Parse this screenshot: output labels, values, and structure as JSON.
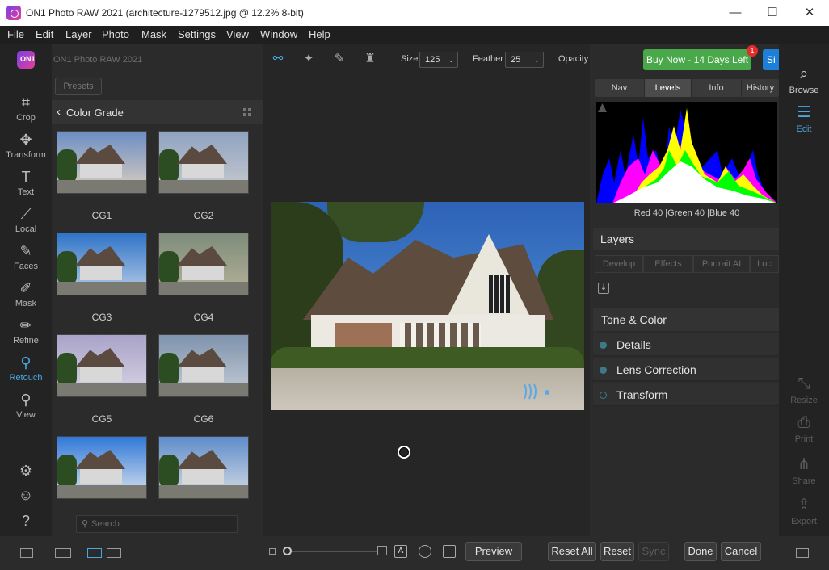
{
  "window": {
    "title": "ON1 Photo RAW 2021 (architecture-1279512.jpg @ 12.2% 8-bit)",
    "minimize": "—",
    "maximize": "☐",
    "close": "✕"
  },
  "menu": [
    "File",
    "Edit",
    "Layer",
    "Photo",
    "Mask",
    "Settings",
    "View",
    "Window",
    "Help"
  ],
  "left_tools": [
    {
      "label": "Crop",
      "icon": "crop-icon",
      "glyph": "⌗"
    },
    {
      "label": "Transform",
      "icon": "transform-icon",
      "glyph": "✥"
    },
    {
      "label": "Text",
      "icon": "text-icon",
      "glyph": "T"
    },
    {
      "label": "Local",
      "icon": "local-brush-icon",
      "glyph": "⟋"
    },
    {
      "label": "Faces",
      "icon": "faces-icon",
      "glyph": "✎"
    },
    {
      "label": "Mask",
      "icon": "mask-icon",
      "glyph": "✐"
    },
    {
      "label": "Refine",
      "icon": "refine-icon",
      "glyph": "✏"
    },
    {
      "label": "Retouch",
      "icon": "retouch-icon",
      "glyph": "⚲",
      "active": true
    },
    {
      "label": "View",
      "icon": "view-zoom-icon",
      "glyph": "⚲"
    }
  ],
  "logo_text": "ON1",
  "browser": {
    "app_name": "ON1 Photo RAW 2021",
    "presets_button": "Presets",
    "category_title": "Color Grade",
    "search_placeholder": "Search",
    "presets": [
      {
        "label": "CG1",
        "tone": "warm"
      },
      {
        "label": "CG2",
        "tone": "cool"
      },
      {
        "label": "CG3",
        "tone": "blue"
      },
      {
        "label": "CG4",
        "tone": "olive"
      },
      {
        "label": "CG5",
        "tone": "purple"
      },
      {
        "label": "CG6",
        "tone": "slate"
      },
      {
        "label": "",
        "tone": "vivid"
      },
      {
        "label": "",
        "tone": "natural"
      }
    ]
  },
  "retouch_toolbar": {
    "size_label": "Size",
    "size_value": "125",
    "feather_label": "Feather",
    "feather_value": "25",
    "opacity_label": "Opacity"
  },
  "purchase": {
    "buy_now": "Buy Now - 14 Days Left",
    "notification_count": "1",
    "sign_in": "Si"
  },
  "nav_tabs": [
    "Nav",
    "Levels",
    "Info",
    "History"
  ],
  "nav_active": "Levels",
  "histogram_info": "Red  40  |Green  40  |Blue  40",
  "layers_title": "Layers",
  "module_tabs": [
    "Develop",
    "Effects",
    "Portrait AI",
    "Loc"
  ],
  "sections": {
    "tone_color": "Tone & Color",
    "items": [
      {
        "name": "Details",
        "state": "enabled"
      },
      {
        "name": "Lens Correction",
        "state": "enabled"
      },
      {
        "name": "Transform",
        "state": "disabled"
      }
    ]
  },
  "right_nav": [
    {
      "label": "Browse",
      "icon": "browse-icon",
      "glyph": "⌕",
      "state": "normal"
    },
    {
      "label": "Edit",
      "icon": "edit-sliders-icon",
      "glyph": "☰",
      "state": "active"
    },
    {
      "label": "Resize",
      "icon": "resize-icon",
      "glyph": "⤡",
      "state": "disabled"
    },
    {
      "label": "Print",
      "icon": "print-icon",
      "glyph": "⎙",
      "state": "disabled"
    },
    {
      "label": "Share",
      "icon": "share-icon",
      "glyph": "⋔",
      "state": "disabled"
    },
    {
      "label": "Export",
      "icon": "export-icon",
      "glyph": "⇪",
      "state": "disabled"
    }
  ],
  "bottom": {
    "preview": "Preview",
    "reset_all": "Reset All",
    "reset": "Reset",
    "sync": "Sync",
    "done": "Done",
    "cancel": "Cancel",
    "text_mode": "A"
  },
  "colors": {
    "accent": "#4aa8e0",
    "buy_now_bg": "#49a84a",
    "sign_in_bg": "#1e7fd8",
    "badge": "#e52c2c"
  }
}
